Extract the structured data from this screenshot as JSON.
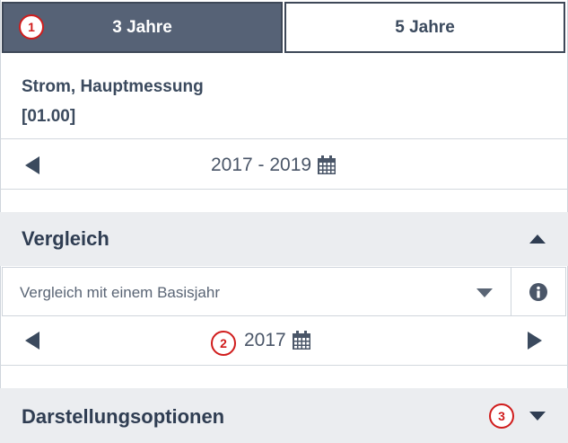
{
  "tabs": [
    {
      "label": "3 Jahre",
      "active": true
    },
    {
      "label": "5 Jahre",
      "active": false
    }
  ],
  "meter": {
    "name": "Strom, Hauptmessung",
    "code": "[01.00]"
  },
  "period": {
    "range": "2017 - 2019"
  },
  "comparison": {
    "title": "Vergleich",
    "select_value": "Vergleich mit einem Basisjahr",
    "base_year": "2017"
  },
  "display_options": {
    "title": "Darstellungsoptionen"
  },
  "markers": [
    "1",
    "2",
    "3"
  ],
  "colors": {
    "active_tab": "#566276",
    "text": "#3b4a5e",
    "section_bg": "#ebedf0",
    "marker": "#d01c1c"
  },
  "icons": {
    "period_prev": "caret-left-icon",
    "calendar": "calendar-icon",
    "section_toggle_open": "caret-up-icon",
    "section_toggle_closed": "caret-down-icon",
    "select_dropdown": "chevron-down-icon",
    "info": "info-icon",
    "year_prev": "caret-left-icon",
    "year_next": "caret-right-icon"
  }
}
